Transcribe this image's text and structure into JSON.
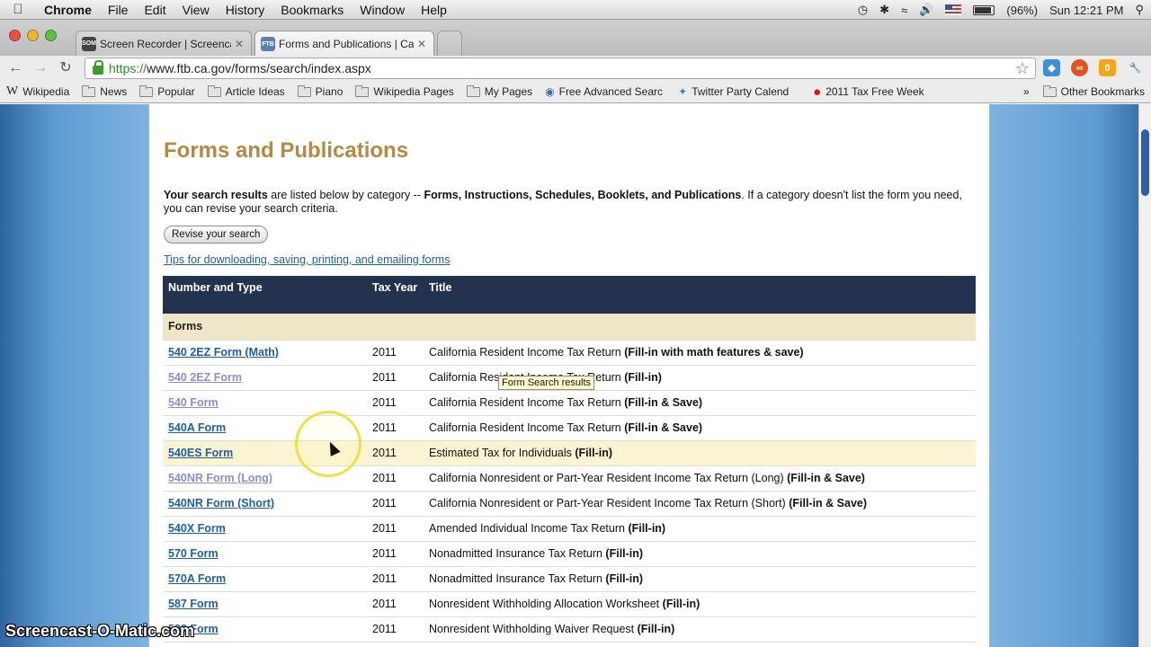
{
  "menubar": {
    "items": [
      "Chrome",
      "File",
      "Edit",
      "View",
      "History",
      "Bookmarks",
      "Window",
      "Help"
    ],
    "battery": "(96%)",
    "clock": "Sun 12:21 PM"
  },
  "tabs": [
    {
      "label": "Screen Recorder | Screencast",
      "favicon": "SOM"
    },
    {
      "label": "Forms and Publications | Ca",
      "favicon": "FTB"
    }
  ],
  "toolbar": {
    "url_scheme": "https://",
    "url_rest": "www.ftb.ca.gov/forms/search/index.aspx",
    "ext_badge": "0"
  },
  "bookmarks": [
    {
      "label": "Wikipedia",
      "icon": "wikipedia-icon"
    },
    {
      "label": "News",
      "icon": "folder-icon"
    },
    {
      "label": "Popular",
      "icon": "folder-icon"
    },
    {
      "label": "Article Ideas",
      "icon": "folder-icon"
    },
    {
      "label": "Piano",
      "icon": "folder-icon"
    },
    {
      "label": "Wikipedia Pages",
      "icon": "folder-icon"
    },
    {
      "label": "My Pages",
      "icon": "folder-icon"
    },
    {
      "label": "Free Advanced Searc",
      "icon": "search-site-icon"
    },
    {
      "label": "Twitter Party Calend",
      "icon": "twitter-icon"
    },
    {
      "label": "2011 Tax Free Week",
      "icon": "red-dot-icon"
    }
  ],
  "bookmarks_other": "Other Bookmarks",
  "page": {
    "title": "Forms and Publications",
    "intro_b1": "Your search results",
    "intro_t1": " are listed below by category -- ",
    "intro_b2": "Forms, Instructions, Schedules, Booklets, and Publications",
    "intro_t2": ". If a category doesn't list the form you need, you can revise your search criteria.",
    "revise_button": "Revise your search",
    "tips_link": "Tips for downloading, saving, printing, and emailing forms",
    "columns": [
      "Number and Type",
      "Tax Year",
      "Title"
    ],
    "category": "Forms",
    "rows": [
      {
        "form": "540 2EZ Form (Math)",
        "year": "2011",
        "title": "California Resident Income Tax Return",
        "suffix": "(Fill-in with math features & save)",
        "visited": false
      },
      {
        "form": "540 2EZ Form",
        "year": "2011",
        "title": "California Resident Income Tax Return",
        "suffix": "(Fill-in)",
        "visited": true
      },
      {
        "form": "540 Form",
        "year": "2011",
        "title": "California Resident Income Tax Return",
        "suffix": "(Fill-in & Save)",
        "visited": true
      },
      {
        "form": "540A Form",
        "year": "2011",
        "title": "California Resident Income Tax Return",
        "suffix": "(Fill-in & Save)",
        "visited": false
      },
      {
        "form": "540ES Form",
        "year": "2011",
        "title": "Estimated Tax for Individuals",
        "suffix": "(Fill-in)",
        "visited": false
      },
      {
        "form": "540NR Form (Long)",
        "year": "2011",
        "title": "California Nonresident or Part-Year Resident Income Tax Return (Long)",
        "suffix": "(Fill-in & Save)",
        "visited": true
      },
      {
        "form": "540NR Form (Short)",
        "year": "2011",
        "title": "California Nonresident or Part-Year Resident Income Tax Return (Short)",
        "suffix": "(Fill-in & Save)",
        "visited": false
      },
      {
        "form": "540X Form",
        "year": "2011",
        "title": "Amended Individual Income Tax Return",
        "suffix": "(Fill-in)",
        "visited": false
      },
      {
        "form": "570 Form",
        "year": "2011",
        "title": "Nonadmitted Insurance Tax Return",
        "suffix": "(Fill-in)",
        "visited": false
      },
      {
        "form": "570A Form",
        "year": "2011",
        "title": "Nonadmitted Insurance Tax Return",
        "suffix": "(Fill-in)",
        "visited": false
      },
      {
        "form": "587 Form",
        "year": "2011",
        "title": "Nonresident Withholding Allocation Worksheet",
        "suffix": "(Fill-in)",
        "visited": false
      },
      {
        "form": "588 Form",
        "year": "2011",
        "title": "Nonresident Withholding Waiver Request",
        "suffix": "(Fill-in)",
        "visited": false
      }
    ],
    "highlighted_row": 4,
    "tooltip": "Form Search results"
  },
  "watermark": "Screencast-O-Matic.com",
  "colors": {
    "title_gold": "#b38a3f",
    "header_navy": "#22324f",
    "category_beige": "#efe6c8",
    "link_blue": "#1e5fa5",
    "visited_link": "#8a8fc9"
  }
}
